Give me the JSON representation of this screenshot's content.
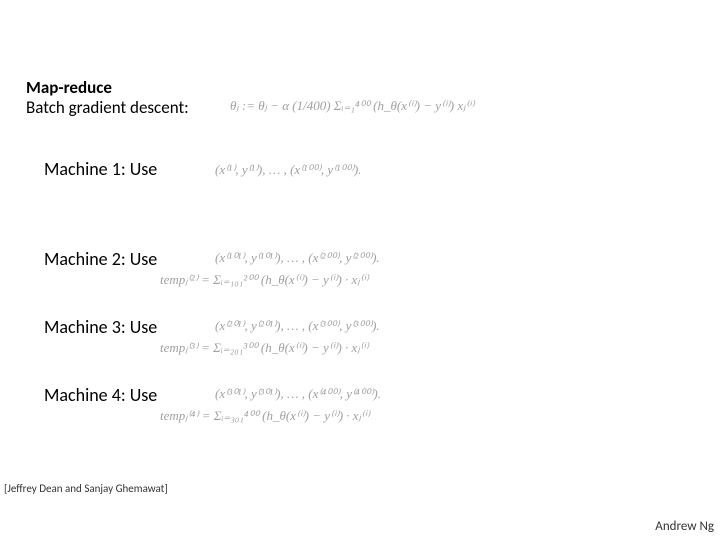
{
  "heading": {
    "title": "Map-reduce",
    "subtitle": "Batch gradient descent:"
  },
  "formula_heading": "θⱼ := θⱼ − α (1/400) Σᵢ₌₁⁴⁰⁰ (h_θ(x⁽ⁱ⁾) − y⁽ⁱ⁾) xⱼ⁽ⁱ⁾",
  "machines": [
    {
      "label": "Machine 1: Use",
      "range": "(x⁽¹⁾, y⁽¹⁾), … , (x⁽¹⁰⁰⁾, y⁽¹⁰⁰⁾).",
      "temp": ""
    },
    {
      "label": "Machine 2: Use",
      "range": "(x⁽¹⁰¹⁾, y⁽¹⁰¹⁾), … , (x⁽²⁰⁰⁾, y⁽²⁰⁰⁾).",
      "temp": "tempⱼ⁽²⁾ = Σᵢ₌₁₀₁²⁰⁰ (h_θ(x⁽ⁱ⁾) − y⁽ⁱ⁾) · xⱼ⁽ⁱ⁾"
    },
    {
      "label": "Machine 3: Use",
      "range": "(x⁽²⁰¹⁾, y⁽²⁰¹⁾), … , (x⁽³⁰⁰⁾, y⁽³⁰⁰⁾).",
      "temp": "tempⱼ⁽³⁾ = Σᵢ₌₂₀₁³⁰⁰ (h_θ(x⁽ⁱ⁾) − y⁽ⁱ⁾) · xⱼ⁽ⁱ⁾"
    },
    {
      "label": "Machine 4: Use",
      "range": "(x⁽³⁰¹⁾, y⁽³⁰¹⁾), … , (x⁽⁴⁰⁰⁾, y⁽⁴⁰⁰⁾).",
      "temp": "tempⱼ⁽⁴⁾ = Σᵢ₌₃₀₁⁴⁰⁰ (h_θ(x⁽ⁱ⁾) − y⁽ⁱ⁾) · xⱼ⁽ⁱ⁾"
    }
  ],
  "citation": "[Jeffrey Dean and Sanjay Ghemawat]",
  "author": "Andrew Ng"
}
